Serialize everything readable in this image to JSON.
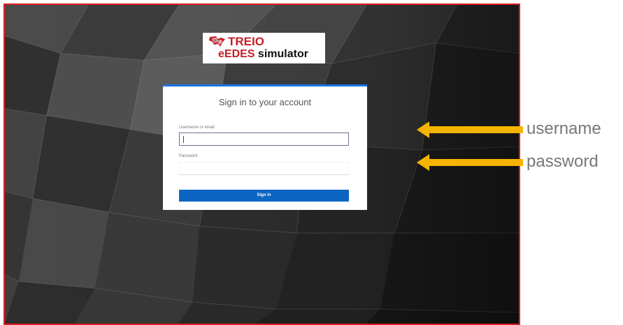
{
  "app": {
    "brand_top": "TREIO",
    "brand_sub_part1": "eEDES",
    "brand_sub_part2": "simulator"
  },
  "login": {
    "title": "Sign in to your account",
    "username_label": "Username or email",
    "password_label": "Password",
    "username_value": "",
    "password_value": "",
    "signin_label": "Sign in"
  },
  "annotations": {
    "username": "username",
    "password": "password"
  },
  "colors": {
    "frame_border": "#e01c24",
    "arrow": "#f4b400",
    "button": "#0a66c2",
    "brand": "#c51f24",
    "annotation_text": "#777777"
  },
  "icons": {
    "logo": "stylized-red-map-logo",
    "annotation_arrow": "left-arrow"
  }
}
